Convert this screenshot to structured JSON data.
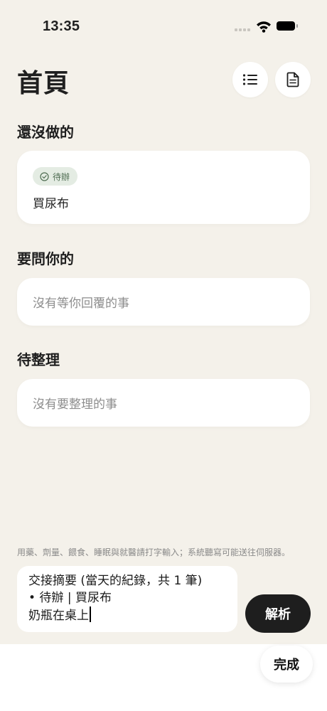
{
  "status_bar": {
    "time": "13:35"
  },
  "header": {
    "title": "首頁"
  },
  "sections": {
    "todo": {
      "heading": "還沒做的",
      "badge": "待辦",
      "item": "買尿布"
    },
    "questions": {
      "heading": "要問你的",
      "empty_text": "沒有等你回覆的事"
    },
    "to_organize": {
      "heading": "待整理",
      "empty_text": "沒有要整理的事"
    }
  },
  "composer": {
    "hint": "用藥、劑量、餵食、睡眠與就醫請打字輸入；系統聽寫可能送往伺服器。",
    "lines": [
      "交接摘要 (當天的紀錄，共 1 筆)",
      "• 待辦 | 買尿布",
      "奶瓶在桌上"
    ],
    "parse_label": "解析"
  },
  "keyboard": {
    "done_label": "完成"
  },
  "icons": {
    "wifi": "wifi-icon",
    "battery": "battery-icon",
    "list": "list-icon",
    "document": "document-icon",
    "check": "check-circle-icon"
  },
  "colors": {
    "background": "#f4f1ea",
    "card": "#ffffff",
    "badge_bg": "#e4ece3",
    "badge_text": "#4f6d52",
    "primary_button": "#1e1e1e"
  }
}
